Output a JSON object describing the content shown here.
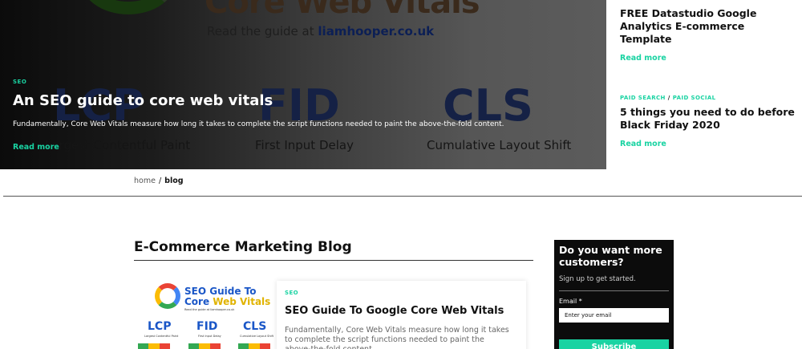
{
  "hero": {
    "image_headline": "Core Web Vitals",
    "image_subline_prefix": "Read the guide at ",
    "image_subline_site": "liamhooper.co.uk",
    "image_metrics": [
      {
        "abbr": "LCP",
        "label": "Largest Contentful Paint"
      },
      {
        "abbr": "FID",
        "label": "First Input Delay"
      },
      {
        "abbr": "CLS",
        "label": "Cumulative Layout Shift"
      }
    ],
    "tag": "SEO",
    "title": "An SEO guide to core web vitals",
    "excerpt": "Fundamentally, Core Web Vitals measure how long it takes to complete the script functions needed to paint the above-the-fold content.",
    "read_more": "Read more"
  },
  "side_posts": [
    {
      "tags": [],
      "title": "FREE Datastudio Google Analytics E-commerce Template",
      "read_more": "Read more"
    },
    {
      "tags": [
        "PAID SEARCH",
        "PAID SOCIAL"
      ],
      "tag_separator": "/",
      "title": "5 things you need to do before Black Friday 2020",
      "read_more": "Read more"
    }
  ],
  "breadcrumb": {
    "home": "home",
    "separator": "/",
    "current": "blog"
  },
  "main": {
    "heading": "E-Commerce Marketing Blog",
    "posts": [
      {
        "thumbnail": {
          "title_line1": "SEO Guide To",
          "title_line2_a": "Core ",
          "title_line2_b": "Web Vitals",
          "caption": "Read the guide at liamhooper.co.uk",
          "metrics": [
            {
              "abbr": "LCP",
              "label": "Largest Contentful Paint"
            },
            {
              "abbr": "FID",
              "label": "First Input Delay"
            },
            {
              "abbr": "CLS",
              "label": "Cumulative Layout Shift"
            }
          ]
        },
        "tag": "SEO",
        "title": "SEO Guide To Google Core Web Vitals",
        "excerpt": "Fundamentally, Core Web Vitals measure how long it takes to complete the script functions needed to paint the above-the-fold content."
      }
    ]
  },
  "newsletter": {
    "title": "Do you want more customers?",
    "subtitle": "Sign up to get started.",
    "email_label": "Email *",
    "email_placeholder": "Enter your email",
    "button_label": "Subscribe"
  },
  "colors": {
    "accent": "#19d3a2",
    "dark_panel": "#0c0c0c"
  }
}
